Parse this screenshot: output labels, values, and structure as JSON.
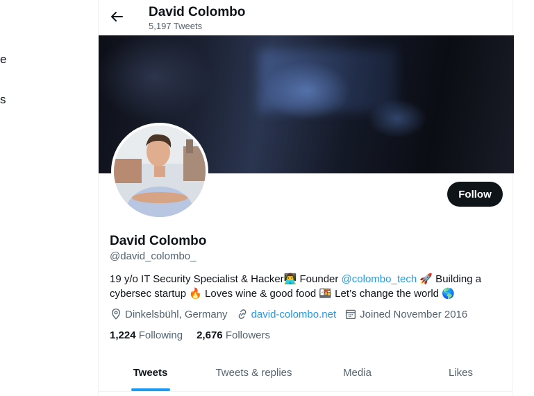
{
  "left_nav": {
    "fragments": [
      "e",
      "s"
    ]
  },
  "header": {
    "name": "David Colombo",
    "tweet_count": "5,197 Tweets"
  },
  "profile": {
    "name": "David Colombo",
    "handle": "@david_colombo_",
    "follow_label": "Follow",
    "bio": {
      "part1": "19 y/o IT Security Specialist & Hacker👨‍💻 Founder ",
      "mention": "@colombo_tech",
      "part2": " 🚀 Building a cybersec startup 🔥 Loves wine & good food 🍱 Let’s change the world 🌎"
    },
    "location": "Dinkelsbühl, Germany",
    "website": "david-colombo.net",
    "joined": "Joined November 2016",
    "following_count": "1,224",
    "following_label": "Following",
    "followers_count": "2,676",
    "followers_label": "Followers"
  },
  "tabs": [
    {
      "label": "Tweets",
      "active": true
    },
    {
      "label": "Tweets & replies",
      "active": false
    },
    {
      "label": "Media",
      "active": false
    },
    {
      "label": "Likes",
      "active": false
    }
  ],
  "colors": {
    "accent": "#1d9bf0",
    "text": "#0f1419",
    "muted": "#536471",
    "button_bg": "#0f1419"
  },
  "icons": [
    "back-arrow-icon",
    "location-icon",
    "link-icon",
    "calendar-icon"
  ]
}
